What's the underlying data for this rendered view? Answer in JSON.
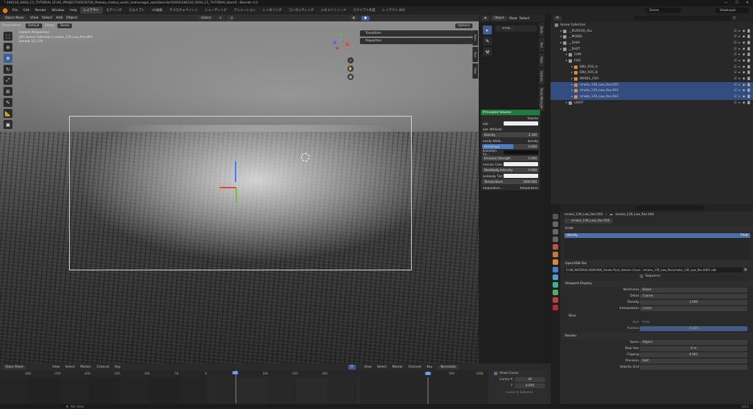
{
  "title_bar": {
    "text": "* 240116_SASA_C1_TUTORIAL [Z:\\01_PROJECT\\20230726_Plateau_matsui_work\\_matsunaga\\_work\\blender\\SASA\\240116_SASA_C1_TUTORIAL.blend] - Blender 4.0",
    "min": "—",
    "max": "☐",
    "close": "✕"
  },
  "menu": {
    "items": [
      "File",
      "Edit",
      "Render",
      "Window",
      "Help"
    ],
    "workspaces": [
      "レイアウト",
      "モデリング",
      "スカルプト",
      "UV編集",
      "テクスチャペイント",
      "シェーディング",
      "アニメーション",
      "レンダリング",
      "コンポジティング",
      "ジオメトリノード",
      "スクリプト作成",
      "レイアウト.001"
    ],
    "active_workspace": "レイアウト",
    "scene": "Scene",
    "view_layer": "ViewLayer"
  },
  "viewport": {
    "mode": "Object Mode",
    "header_menus": [
      "View",
      "Select",
      "Add",
      "Object"
    ],
    "orientation_label": "Orientation:",
    "orientation": "Default",
    "drag_label": "Drag:",
    "drag": "Tweak",
    "transform_space": "Global",
    "options": "Options",
    "info": [
      "Camera Perspective",
      "(45) Scene Collection | smoke_139_Low_Res.003",
      "Sample 1/1 | 24"
    ],
    "npanel": [
      "Transform",
      "Properties"
    ],
    "side_tabs": [
      "Item",
      "Tool",
      "View"
    ]
  },
  "node_panel": {
    "object": "smok...",
    "header_menus": [
      "View",
      "Select"
    ],
    "node_title": "Principled Volume",
    "output": "Volume",
    "rows": [
      {
        "label": "olor",
        "kind": "white"
      },
      {
        "label": "olor Attribute",
        "kind": "label"
      },
      {
        "label": "Density",
        "value": "2.100",
        "kind": "field"
      },
      {
        "label": "ensity Attrib...",
        "value": "density",
        "kind": "label"
      },
      {
        "label": "Anisotropy",
        "value": "0.000",
        "kind": "blue"
      },
      {
        "label": "bsorption Co...",
        "kind": "dark"
      },
      {
        "label": "Emission Strength",
        "value": "0.000",
        "kind": "field"
      },
      {
        "label": "mission Color",
        "kind": "white"
      },
      {
        "label": "Blackbody Intensity",
        "value": "0.000",
        "kind": "field"
      },
      {
        "label": "lackbody Tint",
        "kind": "white"
      },
      {
        "label": "Temperature",
        "value": "1000.000",
        "kind": "field"
      },
      {
        "label": "emperature ...",
        "value": "temperature",
        "kind": "label"
      }
    ],
    "side_tabs": [
      "Node",
      "Tool",
      "View",
      "Options",
      "Node Wrangler"
    ]
  },
  "outliner": {
    "root": "Scene Collection",
    "rows": [
      {
        "indent": 1,
        "label": "__PLATEAU_ALL",
        "sel": false
      },
      {
        "indent": 1,
        "label": "__MODEL",
        "sel": false
      },
      {
        "indent": 1,
        "label": "__SASA",
        "sel": false
      },
      {
        "indent": 1,
        "label": "__SHOT",
        "sel": false
      },
      {
        "indent": 2,
        "label": "CAM",
        "sel": false
      },
      {
        "indent": 2,
        "label": "FOG",
        "sel": false
      },
      {
        "indent": 3,
        "label": "ENV_FOG_A",
        "sel": false
      },
      {
        "indent": 3,
        "label": "ENV_FOG_B",
        "sel": false
      },
      {
        "indent": 3,
        "label": "MODEL_FOG",
        "sel": false
      },
      {
        "indent": 3,
        "label": "smoke_139_Low_Res.003",
        "sel": true
      },
      {
        "indent": 3,
        "label": "smoke_139_Low_Res.003",
        "sel": true
      },
      {
        "indent": 3,
        "label": "smoke_139_Low_Res.003",
        "sel": true
      },
      {
        "indent": 2,
        "label": "LIGHT",
        "sel": false
      }
    ]
  },
  "properties": {
    "breadcrumb": [
      "smoke_139_Low_Res.003",
      "smoke_139_Low_Res.004"
    ],
    "datablock": "smoke_139_Low_Res.004",
    "grids_section": "Grids",
    "grid_item": "density",
    "grid_item_type": "Float",
    "openvdb_section": "OpenVDB File",
    "filepath": "Z:\\08_MATERIAL\\VDB\\VDB_Smoke Pack_Volume Cloud...\\smoke_139_Low_Res\\smoke_139_Low_Res.0001.vdb",
    "sequence": "Sequence",
    "viewport_display": "Viewport Display",
    "viewport_rows": [
      {
        "label": "Wireframe",
        "value": "Boxes"
      },
      {
        "label": "Detail",
        "value": "Coarse"
      },
      {
        "label": "Density",
        "value": "1.000"
      },
      {
        "label": "Interpolation",
        "value": "Linear"
      }
    ],
    "slice": "Slice",
    "axis_label": "Axis",
    "axis_value": "Auto",
    "position_label": "Position",
    "position_value": "0.500",
    "render_section": "Render",
    "render_rows": [
      {
        "label": "Space",
        "value": "Object"
      },
      {
        "label": "Step Size",
        "value": "0 m"
      },
      {
        "label": "Clipping",
        "value": "0.001"
      },
      {
        "label": "Precision",
        "value": "Half"
      },
      {
        "label": "Velocity Grid",
        "value": ""
      }
    ]
  },
  "dopesheet": {
    "mode": "Dope Sheet",
    "menus": [
      "View",
      "Select",
      "Marker",
      "Channel",
      "Key"
    ],
    "ticks": [
      "-300",
      "-250",
      "-200",
      "-150",
      "-100",
      "-50",
      "0",
      "50",
      "100",
      "150",
      "200"
    ],
    "current_frame": "45"
  },
  "graph": {
    "menus": [
      "View",
      "Select",
      "Marker",
      "Channel",
      "Key"
    ],
    "normalize": "Normalize",
    "ticks": [
      "500",
      "1000"
    ],
    "current_frame": "45",
    "show_cursor": "Show Cursor",
    "cursor_x_label": "Cursor X",
    "cursor_x": "45",
    "cursor_y_label": "Y",
    "cursor_y": "0.000",
    "cursor_btn": "Cursor to Selection"
  },
  "status": {
    "left": "Pan View",
    "right": "4.0.1"
  }
}
